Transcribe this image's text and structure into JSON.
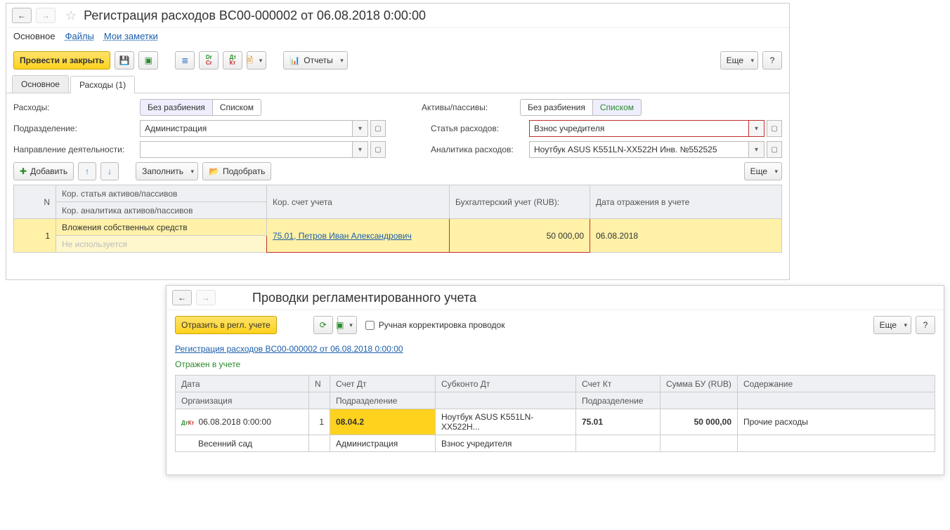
{
  "win1": {
    "title": "Регистрация расходов BC00-000002 от 06.08.2018 0:00:00",
    "header_links": {
      "main": "Основное",
      "files": "Файлы",
      "notes": "Мои заметки"
    },
    "toolbar": {
      "post_close": "Провести и закрыть",
      "reports": "Отчеты",
      "more": "Еще"
    },
    "tabs": {
      "main": "Основное",
      "expenses": "Расходы (1)"
    },
    "labels": {
      "expenses": "Расходы:",
      "assets": "Активы/пассивы:",
      "no_split": "Без разбиения",
      "by_list": "Списком",
      "department": "Подразделение:",
      "expense_item": "Статья расходов:",
      "activity": "Направление деятельности:",
      "analytics": "Аналитика расходов:"
    },
    "fields": {
      "department": "Администрация",
      "expense_item": "Взнос учредителя",
      "activity": "",
      "analytics": "Ноутбук ASUS K551LN-XX522H Инв. №552525"
    },
    "tbl_toolbar": {
      "add": "Добавить",
      "fill": "Заполнить",
      "pick": "Подобрать",
      "more": "Еще"
    },
    "table": {
      "cols": {
        "n": "N",
        "item1": "Кор. статья активов/пассивов",
        "item2": "Кор. аналитика активов/пассивов",
        "acct": "Кор. счет учета",
        "acc_rub": "Бухгалтерский учет (RUB):",
        "date": "Дата отражения в учете"
      },
      "row": {
        "n": "1",
        "item": "Вложения собственных средств",
        "not_used": "Не используется",
        "acct": "75.01, Петров Иван Александрович",
        "amount": "50 000,00",
        "date": "06.08.2018"
      }
    }
  },
  "win2": {
    "title": "Проводки регламентированного учета",
    "reflect": "Отразить в регл. учете",
    "manual": "Ручная корректировка проводок",
    "more": "Еще",
    "doc_link": "Регистрация расходов BC00-000002 от 06.08.2018 0:00:00",
    "status": "Отражен в учете",
    "cols": {
      "date": "Дата",
      "n": "N",
      "acc_dt": "Счет Дт",
      "sub_dt": "Субконто Дт",
      "acc_kt": "Счет Кт",
      "sum": "Сумма БУ (RUB)",
      "desc": "Содержание",
      "org": "Организация",
      "dept": "Подразделение",
      "dept2": "Подразделение"
    },
    "row": {
      "date": "06.08.2018 0:00:00",
      "n": "1",
      "acc_dt": "08.04.2",
      "sub_dt": "Ноутбук ASUS K551LN-XX522H...",
      "acc_kt": "75.01",
      "sum": "50 000,00",
      "desc": "Прочие расходы",
      "org": "Весенний сад",
      "dept": "Администрация",
      "sub_dt2": "Взнос учредителя"
    }
  }
}
